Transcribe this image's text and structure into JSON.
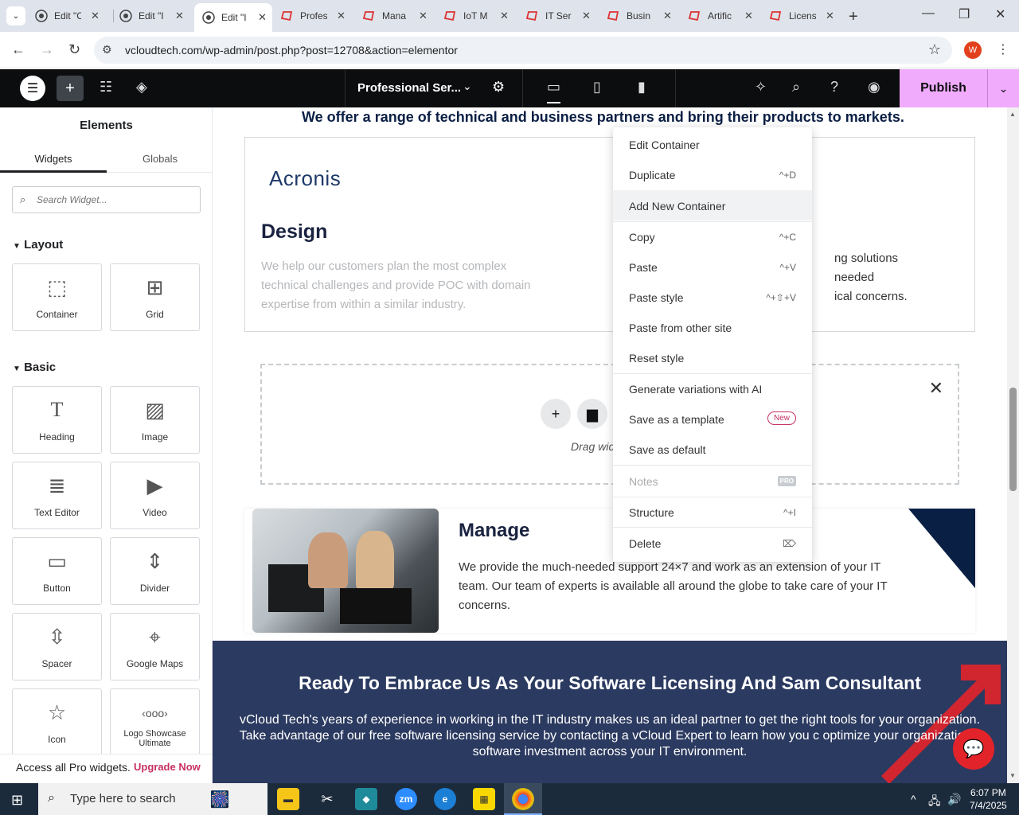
{
  "browser": {
    "tabs": [
      {
        "title": "Edit \"C",
        "icon": "wordpress-icon"
      },
      {
        "title": "Edit \"I",
        "icon": "wordpress-icon"
      },
      {
        "title": "Edit \"I",
        "icon": "wordpress-icon",
        "active": true
      },
      {
        "title": "Profes",
        "icon": "elementor-icon"
      },
      {
        "title": "Mana",
        "icon": "elementor-icon"
      },
      {
        "title": "IoT M",
        "icon": "elementor-icon"
      },
      {
        "title": "IT Ser",
        "icon": "elementor-icon"
      },
      {
        "title": "Busin",
        "icon": "elementor-icon"
      },
      {
        "title": "Artific",
        "icon": "elementor-icon"
      },
      {
        "title": "Licens",
        "icon": "elementor-icon"
      }
    ],
    "url": "vcloudtech.com/wp-admin/post.php?post=12708&action=elementor",
    "profile_initial": "W"
  },
  "editor": {
    "document_name": "Professional Ser...",
    "publish_label": "Publish"
  },
  "panel": {
    "title": "Elements",
    "tabs": [
      "Widgets",
      "Globals"
    ],
    "search_placeholder": "Search Widget...",
    "sections": {
      "layout": "Layout",
      "basic": "Basic"
    },
    "layout_widgets": [
      "Container",
      "Grid"
    ],
    "basic_widgets": [
      "Heading",
      "Image",
      "Text Editor",
      "Video",
      "Button",
      "Divider",
      "Spacer",
      "Google Maps",
      "Icon",
      "Logo Showcase Ultimate"
    ],
    "pro_text": "Access all Pro widgets.",
    "upgrade_label": "Upgrade Now"
  },
  "canvas": {
    "intro": "We offer a range of technical and business partners and bring their products to markets.",
    "logo_text": "Acronis",
    "design_title": "Design",
    "design_text": "We help our customers plan the most complex technical challenges and provide POC with domain expertise from within a similar industry.",
    "right_text": [
      "ng solutions",
      "needed",
      "ical concerns."
    ],
    "dropzone_hint": "Drag widg",
    "manage_title": "Manage",
    "manage_text": "We provide the much-needed support 24×7 and work as an extension of your IT team. Our team of experts is available all around the globe to take care of your IT concerns.",
    "banner_title": "Ready To Embrace Us As Your Software Licensing And Sam Consultant",
    "banner_text": "vCloud Tech's years of experience in working in the IT industry makes us an ideal partner to get the right tools for your organization. Take advantage of our free software licensing service by contacting a vCloud Expert to learn how you c optimize your organization's software investment across your IT environment."
  },
  "context_menu": {
    "items": [
      {
        "label": "Edit Container",
        "shortcut": ""
      },
      {
        "label": "Duplicate",
        "shortcut": "^+D"
      },
      {
        "label": "Add New Container",
        "shortcut": ""
      },
      {
        "label": "Copy",
        "shortcut": "^+C"
      },
      {
        "label": "Paste",
        "shortcut": "^+V"
      },
      {
        "label": "Paste style",
        "shortcut": "^+⇧+V"
      },
      {
        "label": "Paste from other site",
        "shortcut": ""
      },
      {
        "label": "Reset style",
        "shortcut": ""
      },
      {
        "label": "Generate variations with AI",
        "shortcut": ""
      },
      {
        "label": "Save as a template",
        "shortcut": ""
      },
      {
        "label": "Save as default",
        "shortcut": ""
      },
      {
        "label": "Notes",
        "shortcut": ""
      },
      {
        "label": "Structure",
        "shortcut": "^+I"
      },
      {
        "label": "Delete",
        "shortcut": "⌦"
      }
    ],
    "badge_new": "New",
    "badge_pro": "PRO"
  },
  "taskbar": {
    "search_placeholder": "Type here to search",
    "time": "6:07 PM",
    "date": "7/4/2025"
  },
  "colors": {
    "accent_pink": "#f0abfc",
    "upgrade_red": "#c62f63",
    "navy": "#0a1f44",
    "banner_bg": "#2b3a60",
    "chat_red": "#e3232a"
  }
}
